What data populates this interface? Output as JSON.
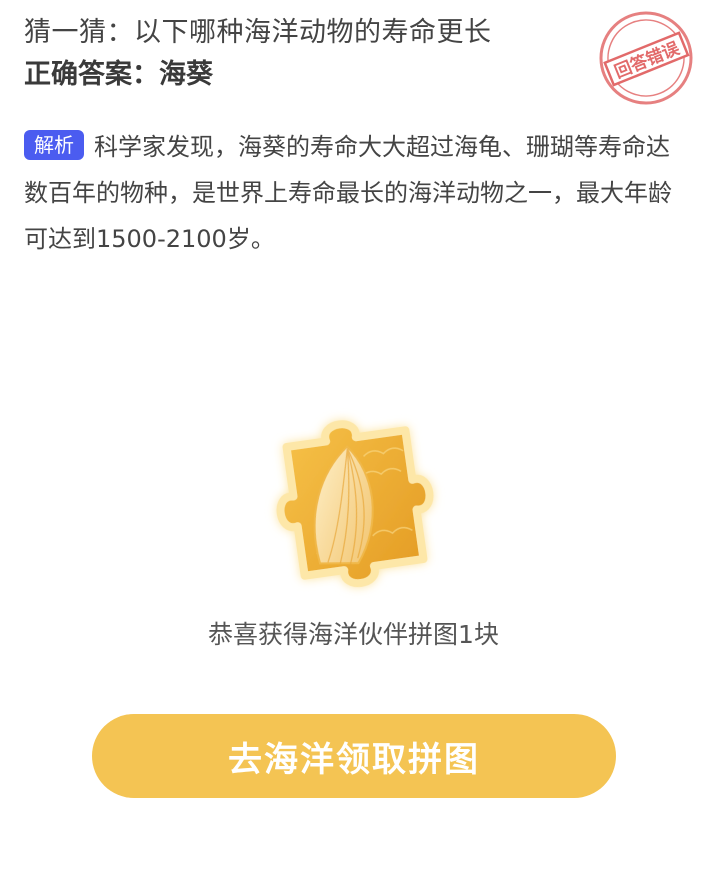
{
  "question": "猜一猜：以下哪种海洋动物的寿命更长",
  "answer": "正确答案：海葵",
  "stamp": {
    "text": "回答错误",
    "color": "#e26a6a"
  },
  "analysis": {
    "tag": "解析",
    "text": "科学家发现，海葵的寿命大大超过海龟、珊瑚等寿命达数百年的物种，是世界上寿命最长的海洋动物之一，最大年龄可达到1500-2100岁。"
  },
  "reward": {
    "icon": "puzzle-piece-icon",
    "text": "恭喜获得海洋伙伴拼图1块"
  },
  "cta": {
    "label": "去海洋领取拼图",
    "color": "#f4c453"
  }
}
